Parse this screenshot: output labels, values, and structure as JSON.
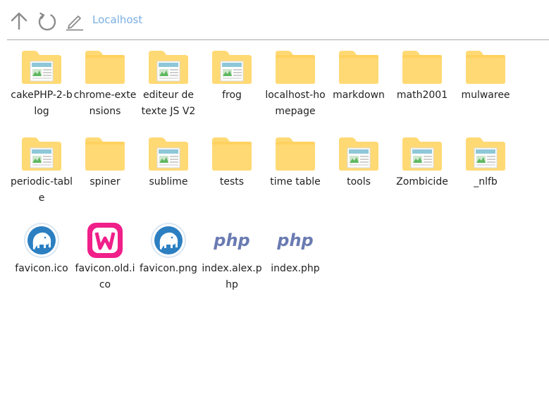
{
  "toolbar": {
    "up_icon": "arrow-up-icon",
    "refresh_icon": "refresh-icon",
    "edit_icon": "pencil-icon",
    "breadcrumb": "Localhost"
  },
  "colors": {
    "folder": "#ffd974",
    "folder_tab": "#ffc94a",
    "breadcrumb": "#79aee3",
    "php": "#6a7bb2",
    "wamp": "#f01f8a",
    "elephant_ring": "#2c7fc1"
  },
  "items": [
    {
      "label": "cakePHP-2-blog",
      "icon": "folder-web-icon"
    },
    {
      "label": "chrome-extensions",
      "icon": "folder-icon"
    },
    {
      "label": "editeur de texte JS V2",
      "icon": "folder-web-icon"
    },
    {
      "label": "frog",
      "icon": "folder-web-icon"
    },
    {
      "label": "localhost-homepage",
      "icon": "folder-icon"
    },
    {
      "label": "markdown",
      "icon": "folder-icon"
    },
    {
      "label": "math2001",
      "icon": "folder-icon"
    },
    {
      "label": "mulwaree",
      "icon": "folder-icon"
    },
    {
      "label": "periodic-table",
      "icon": "folder-web-icon"
    },
    {
      "label": "spiner",
      "icon": "folder-icon"
    },
    {
      "label": "sublime",
      "icon": "folder-web-icon"
    },
    {
      "label": "tests",
      "icon": "folder-icon"
    },
    {
      "label": "time table",
      "icon": "folder-icon"
    },
    {
      "label": "tools",
      "icon": "folder-web-icon"
    },
    {
      "label": "Zombicide",
      "icon": "folder-web-icon"
    },
    {
      "label": "_nlfb",
      "icon": "folder-web-icon"
    },
    {
      "label": "favicon.ico",
      "icon": "elephant-icon"
    },
    {
      "label": "favicon.old.ico",
      "icon": "wamp-icon"
    },
    {
      "label": "favicon.png",
      "icon": "elephant-icon"
    },
    {
      "label": "index.alex.php",
      "icon": "php-file-icon",
      "php_text": "php"
    },
    {
      "label": "index.php",
      "icon": "php-file-icon",
      "php_text": "php"
    }
  ]
}
